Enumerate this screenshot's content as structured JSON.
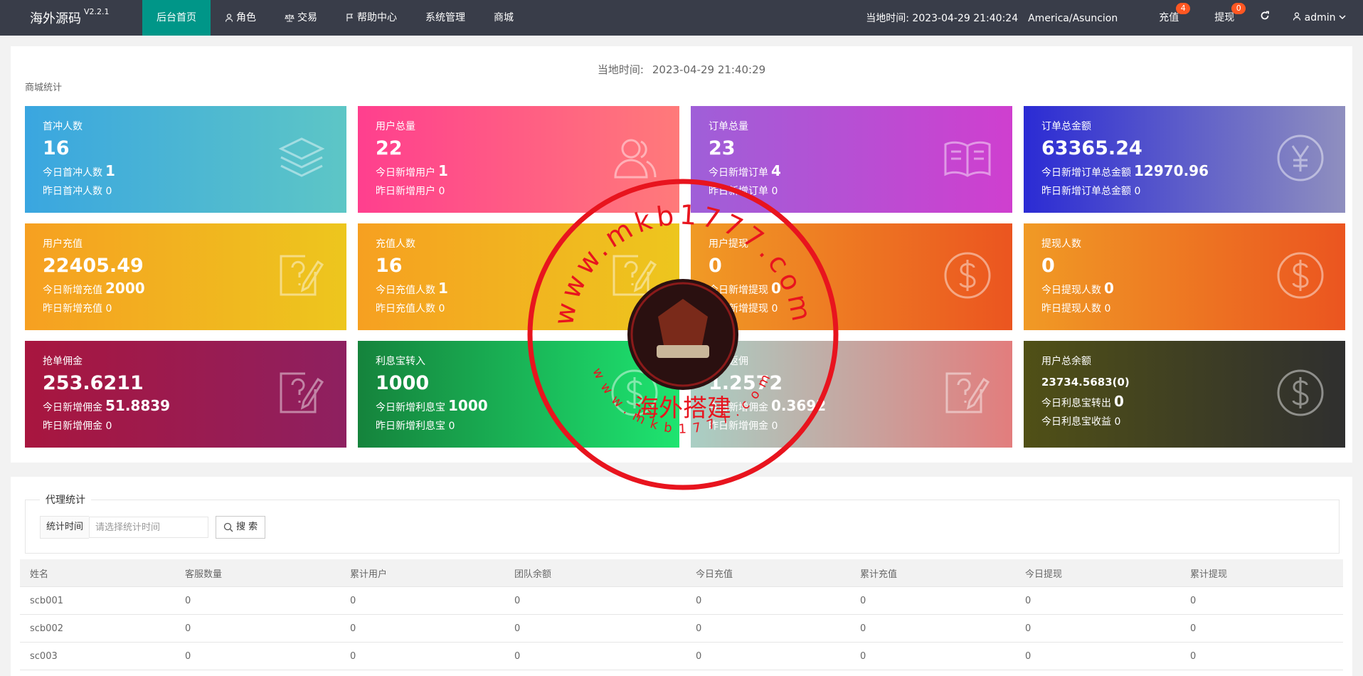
{
  "header": {
    "logo": "海外源码",
    "version": "V2.2.1",
    "nav": [
      {
        "label": "后台首页",
        "icon": "",
        "active": true
      },
      {
        "label": "角色",
        "icon": "user-icon"
      },
      {
        "label": "交易",
        "icon": "scale-icon"
      },
      {
        "label": "帮助中心",
        "icon": "flag-icon"
      },
      {
        "label": "系统管理",
        "icon": ""
      },
      {
        "label": "商城",
        "icon": ""
      }
    ],
    "local_time": "当地时间: 2023-04-29 21:40:24",
    "timezone": "America/Asuncion",
    "recharge": {
      "label": "充值",
      "badge": "4"
    },
    "withdraw": {
      "label": "提现",
      "badge": "0"
    },
    "user": "admin"
  },
  "stats": {
    "time_label": "当地时间:",
    "time_value": "2023-04-29 21:40:29",
    "section_label": "商城统计",
    "cards": [
      {
        "title": "首冲人数",
        "value": "16",
        "sub_label": "今日首冲人数",
        "sub_value": "1",
        "sub2": "昨日首冲人数 0",
        "icon": "layers-icon",
        "gradient": [
          "#3aa6e0",
          "#5dc6c6"
        ]
      },
      {
        "title": "用户总量",
        "value": "22",
        "sub_label": "今日新增用户",
        "sub_value": "1",
        "sub2": "昨日新增用户 0",
        "icon": "users-icon",
        "gradient": [
          "#ff3f8e",
          "#ff7a7a"
        ]
      },
      {
        "title": "订单总量",
        "value": "23",
        "sub_label": "今日新增订单",
        "sub_value": "4",
        "sub2": "昨日新增订单 0",
        "icon": "book-icon",
        "gradient": [
          "#9f5fd8",
          "#cf3fcf"
        ]
      },
      {
        "title": "订单总金额",
        "value": "63365.24",
        "sub_label": "今日新增订单总金额",
        "sub_value": "12970.96",
        "sub2": "昨日新增订单总金额 0",
        "icon": "yen-icon",
        "gradient": [
          "#2b2bd4",
          "#8f8fbf"
        ]
      },
      {
        "title": "用户充值",
        "value": "22405.49",
        "sub_label": "今日新增充值",
        "sub_value": "2000",
        "sub2": "昨日新增充值 0",
        "icon": "edit-question-icon",
        "gradient": [
          "#f6a021",
          "#edc61e"
        ]
      },
      {
        "title": "充值人数",
        "value": "16",
        "sub_label": "今日充值人数",
        "sub_value": "1",
        "sub2": "昨日充值人数 0",
        "icon": "edit-question-icon",
        "gradient": [
          "#f6a021",
          "#edc61e"
        ]
      },
      {
        "title": "用户提现",
        "value": "0",
        "sub_label": "今日新增提现",
        "sub_value": "0",
        "sub2": "昨日新增提现 0",
        "icon": "dollar-icon",
        "gradient": [
          "#f09a25",
          "#eb5520"
        ]
      },
      {
        "title": "提现人数",
        "value": "0",
        "sub_label": "今日提现人数",
        "sub_value": "0",
        "sub2": "昨日提现人数 0",
        "icon": "dollar-icon",
        "gradient": [
          "#f09a25",
          "#eb5520"
        ]
      },
      {
        "title": "抢单佣金",
        "value": "253.6211",
        "sub_label": "今日新增佣金",
        "sub_value": "51.8839",
        "sub2": "昨日新增佣金 0",
        "icon": "edit-question-icon",
        "gradient": [
          "#a8163f",
          "#8e2060"
        ]
      },
      {
        "title": "利息宝转入",
        "value": "1000",
        "sub_label": "今日新增利息宝",
        "sub_value": "1000",
        "sub2": "昨日新增利息宝 0",
        "icon": "dollar-icon",
        "gradient": [
          "#15833c",
          "#1ee470"
        ]
      },
      {
        "title": "下级返佣",
        "value": "1.2572",
        "sub_label": "今日新增佣金",
        "sub_value": "0.3692",
        "sub2": "昨日新增佣金 0",
        "icon": "edit-question-icon",
        "gradient": [
          "#a9cfc4",
          "#e27d7d"
        ]
      },
      {
        "title": "用户总余额",
        "value": "23734.5683(0)",
        "sub_label": "今日利息宝转出",
        "sub_value": "0",
        "sub2": "今日利息宝收益 0",
        "icon": "dollar-icon",
        "gradient": [
          "#505016",
          "#2f2f2f"
        ],
        "small_value": true
      }
    ]
  },
  "agent": {
    "legend": "代理统计",
    "time_label": "统计时间",
    "time_placeholder": "请选择统计时间",
    "search_label": "搜 索",
    "columns": [
      "姓名",
      "客服数量",
      "累计用户",
      "团队余额",
      "今日充值",
      "累计充值",
      "今日提现",
      "累计提现"
    ],
    "rows": [
      [
        "scb001",
        "0",
        "0",
        "0",
        "0",
        "0",
        "0",
        "0"
      ],
      [
        "scb002",
        "0",
        "0",
        "0",
        "0",
        "0",
        "0",
        "0"
      ],
      [
        "sc003",
        "0",
        "0",
        "0",
        "0",
        "0",
        "0",
        "0"
      ]
    ]
  },
  "watermark": {
    "top_text": "www.mkb1777.com",
    "center_text": "海外搭建",
    "bottom_text": "www.mkb1777.com",
    "color": "#e8141e"
  }
}
